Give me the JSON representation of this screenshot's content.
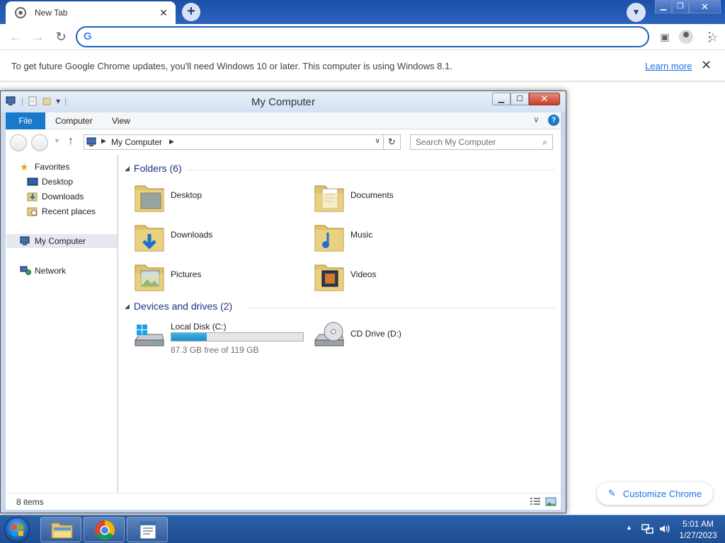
{
  "chrome": {
    "tab_title": "New Tab",
    "omnibox_value": "",
    "omnibox_placeholder": "",
    "infobar_text": "To get future Google Chrome updates, you'll need Windows 10 or later. This computer is using Windows 8.1.",
    "learn_more": "Learn more",
    "customize_label": "Customize Chrome",
    "accent_color": "#1a73e8",
    "frame_color": "#2d63bf"
  },
  "explorer": {
    "window_title": "My Computer",
    "ribbon_tabs": {
      "file": "File",
      "computer": "Computer",
      "view": "View"
    },
    "help_label": "?",
    "address": "My Computer",
    "search_placeholder": "Search My Computer",
    "nav_pane": {
      "favorites": "Favorites",
      "desktop": "Desktop",
      "downloads": "Downloads",
      "recent_places": "Recent places",
      "my_computer": "My Computer",
      "network": "Network"
    },
    "folders_header": "Folders (6)",
    "folders": [
      {
        "name": "Desktop",
        "icon": "desktop-folder-icon"
      },
      {
        "name": "Documents",
        "icon": "documents-folder-icon"
      },
      {
        "name": "Downloads",
        "icon": "downloads-folder-icon"
      },
      {
        "name": "Music",
        "icon": "music-folder-icon"
      },
      {
        "name": "Pictures",
        "icon": "pictures-folder-icon"
      },
      {
        "name": "Videos",
        "icon": "videos-folder-icon"
      }
    ],
    "devices_header": "Devices and drives (2)",
    "drives": [
      {
        "name": "Local Disk (C:)",
        "free_text": "87.3 GB free of 119 GB",
        "used_fraction": 0.27,
        "icon": "local-disk-icon"
      },
      {
        "name": "CD Drive (D:)",
        "icon": "cd-drive-icon"
      }
    ],
    "status_count": "8 items",
    "selection_color": "#e5e9ef",
    "file_tab_color": "#1979ca",
    "header_color": "#1e3287"
  },
  "taskbar": {
    "time": "5:01 AM",
    "date": "1/27/2023"
  }
}
